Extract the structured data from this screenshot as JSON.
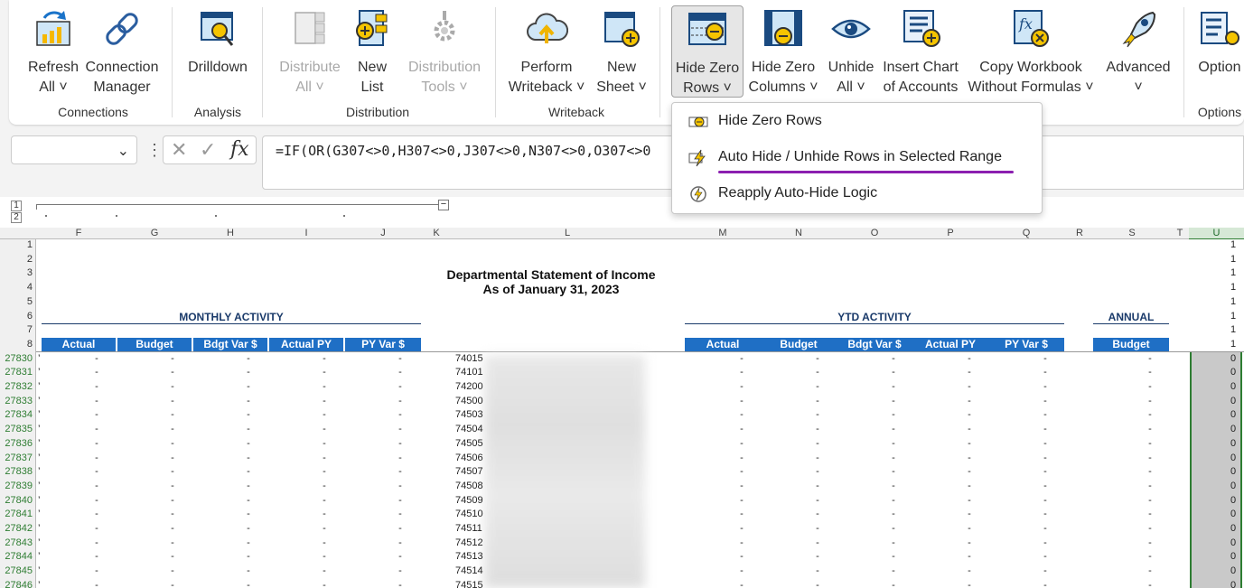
{
  "ribbon": {
    "groups": [
      {
        "label": "Connections"
      },
      {
        "label": "Analysis"
      },
      {
        "label": "Distribution"
      },
      {
        "label": "Writeback"
      },
      {
        "label": "Options"
      }
    ],
    "buttons": [
      {
        "line1": "Refresh",
        "line2": "All ˅",
        "icon": "refresh-chart-icon"
      },
      {
        "line1": "Connection",
        "line2": "Manager",
        "icon": "link-icon"
      },
      {
        "line1": "Drilldown",
        "line2": "",
        "icon": "drilldown-icon"
      },
      {
        "line1": "Distribute",
        "line2": "All ˅",
        "icon": "distribute-icon"
      },
      {
        "line1": "New",
        "line2": "List",
        "icon": "new-list-icon"
      },
      {
        "line1": "Distribution",
        "line2": "Tools ˅",
        "icon": "gear-tools-icon"
      },
      {
        "line1": "Perform",
        "line2": "Writeback ˅",
        "icon": "cloud-upload-icon"
      },
      {
        "line1": "New",
        "line2": "Sheet ˅",
        "icon": "new-sheet-icon"
      },
      {
        "line1": "Hide Zero",
        "line2": "Rows ˅",
        "icon": "hide-rows-icon"
      },
      {
        "line1": "Hide Zero",
        "line2": "Columns ˅",
        "icon": "hide-columns-icon"
      },
      {
        "line1": "Unhide",
        "line2": "All ˅",
        "icon": "eye-icon"
      },
      {
        "line1": "Insert Chart",
        "line2": "of Accounts",
        "icon": "insert-chart-icon"
      },
      {
        "line1": "Copy Workbook",
        "line2": "Without Formulas ˅",
        "icon": "fx-icon"
      },
      {
        "line1": "Advanced",
        "line2": "˅",
        "icon": "rocket-icon"
      },
      {
        "line1": "Option",
        "line2": "",
        "icon": "options-icon"
      }
    ]
  },
  "formula_bar": {
    "name_box": "",
    "formula": "=IF(OR(G307<>0,H307<>0,J307<>0,N307<>0,O307<>0"
  },
  "dropdown": {
    "items": [
      {
        "label": "Hide Zero Rows",
        "icon": "hide-rows-small-icon"
      },
      {
        "label": "Auto Hide / Unhide Rows in Selected Range",
        "icon": "lightning-icon"
      },
      {
        "label": "Reapply Auto-Hide Logic",
        "icon": "reapply-icon"
      }
    ],
    "underline_color": "#8b1fb0"
  },
  "outline_levels": [
    "1",
    "2"
  ],
  "columns": [
    "F",
    "G",
    "H",
    "I",
    "J",
    "K",
    "L",
    "M",
    "N",
    "O",
    "P",
    "Q",
    "R",
    "S",
    "T",
    "U"
  ],
  "rows": [
    "1",
    "2",
    "3",
    "4",
    "5",
    "6",
    "7",
    "8",
    "27830",
    "27831",
    "27832",
    "27833",
    "27834",
    "27835",
    "27836",
    "27837",
    "27838",
    "27839",
    "27840",
    "27841",
    "27842",
    "27843",
    "27844",
    "27845",
    "27846"
  ],
  "report": {
    "title": "Departmental  Statement of Income",
    "subtitle": "As of  January 31, 2023",
    "monthly_header": "MONTHLY ACTIVITY",
    "ytd_header": "YTD ACTIVITY",
    "annual_header": "ANNUAL",
    "monthly_cols": [
      "Actual",
      "Budget",
      "Bdgt Var $",
      "Actual PY",
      "PY Var $"
    ],
    "ytd_cols": [
      "Actual",
      "Budget",
      "Bdgt Var $",
      "Actual PY",
      "PY Var $"
    ],
    "annual_cols": [
      "Budget"
    ],
    "header_one": "1",
    "accounts": [
      "74015",
      "74101",
      "74200",
      "74500",
      "74503",
      "74504",
      "74505",
      "74506",
      "74507",
      "74508",
      "74509",
      "74510",
      "74511",
      "74512",
      "74513",
      "74514",
      "74515"
    ],
    "dash": "-",
    "u_value": "0"
  },
  "colors": {
    "header_blue": "#1f6fc5",
    "row_num_green": "#2e7d32",
    "purple": "#8b1fb0"
  }
}
